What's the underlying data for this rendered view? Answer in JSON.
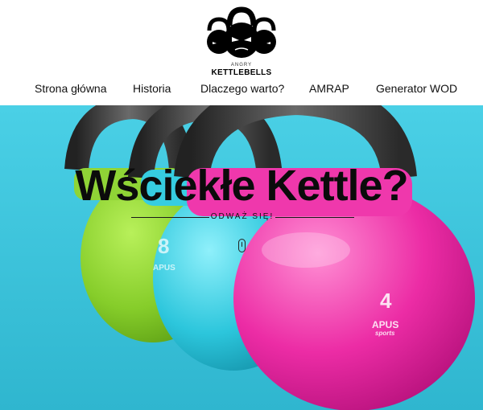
{
  "logo": {
    "small": "ANGRY",
    "big": "KETTLEBELLS"
  },
  "nav": {
    "items": [
      {
        "label": "Strona główna"
      },
      {
        "label": "Historia"
      },
      {
        "label": "Dlaczego warto?"
      },
      {
        "label": "AMRAP"
      },
      {
        "label": "Generator WOD"
      }
    ]
  },
  "hero": {
    "title": "Wściekłe Kettle?",
    "subtitle": "ODWAŻ SIĘ!",
    "kettle_green_number": "8",
    "kettle_green_brand": "APUS",
    "kettle_pink_number": "4",
    "kettle_pink_brand": "APUS",
    "kettle_pink_brand_sub": "sports"
  },
  "colors": {
    "background": "#3fc6df",
    "kettle_green": "#8bd12f",
    "kettle_cyan": "#28c8dc",
    "kettle_pink": "#ea2aa3",
    "handle": "#3a3a3a"
  }
}
